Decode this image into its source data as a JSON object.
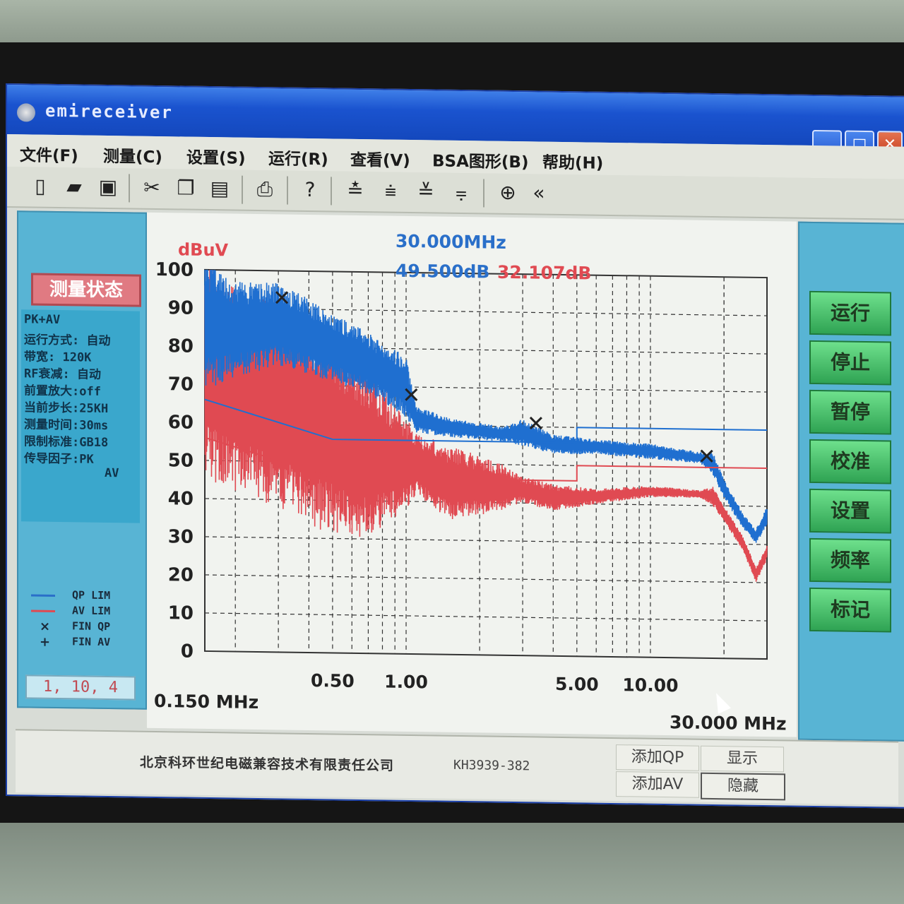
{
  "window": {
    "title": "emireceiver",
    "controls": {
      "minimize": "▁",
      "maximize": "□",
      "close": "✕"
    }
  },
  "menu": [
    "文件(F)",
    "测量(C)",
    "设置(S)",
    "运行(R)",
    "查看(V)",
    "BSA图形(B)",
    "帮助(H)"
  ],
  "toolbar_icons": [
    "new-file-icon",
    "open-folder-icon",
    "save-icon",
    "cut-icon",
    "copy-icon",
    "paste-icon",
    "print-icon",
    "help-icon",
    "align-1-icon",
    "align-2-icon",
    "align-3-icon",
    "align-4-icon",
    "zoom-icon",
    "rewind-icon"
  ],
  "left_panel": {
    "status_title": "测量状态",
    "status_lines": [
      "PK+AV",
      "运行方式: 自动",
      "带宽: 120K",
      "RF衰减: 自动",
      "前置放大:off",
      "当前步长:25KH",
      "测量时间:30ms",
      "限制标准:GB18",
      "传导因子:PK",
      "AV"
    ],
    "legend": [
      {
        "symbol": "",
        "label": "QP LIM",
        "color": "#2a6fc9"
      },
      {
        "symbol": "",
        "label": "AV LIM",
        "color": "#e04a52"
      },
      {
        "symbol": "×",
        "label": "FIN QP",
        "color": "#1a2a3a"
      },
      {
        "symbol": "+",
        "label": "FIN AV",
        "color": "#1a2a3a"
      }
    ],
    "coords": "1, 10, 4"
  },
  "readout": {
    "freq": "30.000MHz",
    "val_qp": "49.500dB",
    "val_av": "32.107dB",
    "unit": "dBuV"
  },
  "chart_data": {
    "type": "line",
    "xscale": "log",
    "xlim": [
      0.15,
      30
    ],
    "ylim": [
      0,
      100
    ],
    "ylabel": "dBuV",
    "y_ticks": [
      0,
      10,
      20,
      30,
      40,
      50,
      60,
      70,
      80,
      90,
      100
    ],
    "x_tick_labels": [
      {
        "value": 0.5,
        "label": "0.50"
      },
      {
        "value": 1.0,
        "label": "1.00"
      },
      {
        "value": 5.0,
        "label": "5.00"
      },
      {
        "value": 10.0,
        "label": "10.00"
      }
    ],
    "x_start_label": "0.150 MHz",
    "x_end_label": "30.000 MHz",
    "colors": {
      "qp": "#1f6fd0",
      "av": "#e04a52",
      "grid": "#333333"
    },
    "series": [
      {
        "name": "QP LIM",
        "x": [
          0.15,
          0.5,
          0.5,
          5,
          5,
          30
        ],
        "y": [
          66,
          56,
          56,
          56,
          60,
          60
        ]
      },
      {
        "name": "AV LIM",
        "x": [
          0.15,
          0.5,
          0.5,
          5,
          5,
          30
        ],
        "y": [
          56,
          46,
          46,
          46,
          50,
          50
        ]
      }
    ],
    "qp_trace_envelope": {
      "x": [
        0.15,
        0.2,
        0.3,
        0.45,
        0.7,
        1.0,
        1.1,
        1.5,
        2.5,
        3.0,
        4.0,
        6.0,
        10.0,
        16.0,
        18.0,
        20.0,
        24.0,
        27.0,
        30.0
      ],
      "top": [
        103,
        97,
        97,
        91,
        84,
        78,
        65,
        62,
        60,
        62,
        58,
        57,
        56,
        54,
        54,
        47,
        38,
        34,
        40
      ],
      "bottom": [
        68,
        72,
        75,
        72,
        68,
        62,
        58,
        57,
        56,
        55,
        53,
        53,
        52,
        51,
        48,
        42,
        34,
        30,
        35
      ]
    },
    "av_trace_envelope": {
      "x": [
        0.15,
        0.2,
        0.3,
        0.45,
        0.7,
        1.0,
        1.1,
        1.5,
        2.5,
        3.0,
        4.0,
        6.0,
        10.0,
        16.0,
        18.0,
        20.0,
        24.0,
        27.0,
        30.0
      ],
      "top": [
        103,
        95,
        92,
        85,
        75,
        62,
        58,
        55,
        50,
        47,
        45,
        44,
        45,
        44,
        45,
        40,
        32,
        24,
        30
      ],
      "bottom": [
        45,
        42,
        38,
        32,
        30,
        38,
        42,
        35,
        38,
        40,
        38,
        40,
        42,
        42,
        40,
        36,
        28,
        20,
        26
      ]
    },
    "markers_qp": [
      {
        "x": 0.31,
        "y": 93
      },
      {
        "x": 1.05,
        "y": 68
      },
      {
        "x": 3.4,
        "y": 61
      },
      {
        "x": 17.0,
        "y": 53
      }
    ]
  },
  "right_buttons": [
    "运行",
    "停止",
    "暂停",
    "校准",
    "设置",
    "频率",
    "标记"
  ],
  "footer": {
    "company": "北京科环世纪电磁兼容技术有限责任公司",
    "model": "KH3939-382",
    "buttons": [
      "添加QP",
      "显示",
      "添加AV",
      "隐藏"
    ]
  }
}
